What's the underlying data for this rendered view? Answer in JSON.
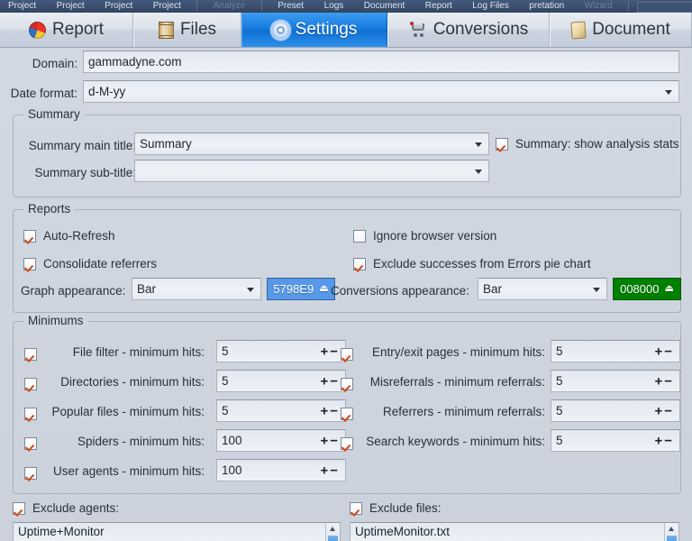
{
  "menu": {
    "items": [
      {
        "label": "Project",
        "faded": false
      },
      {
        "label": "Project",
        "faded": false
      },
      {
        "label": "Project",
        "faded": false
      },
      {
        "label": "Project",
        "faded": false
      },
      {
        "label": "Analyze",
        "faded": true
      },
      {
        "label": "Preset",
        "faded": false
      },
      {
        "label": "Logs",
        "faded": false
      },
      {
        "label": "Document",
        "faded": false
      },
      {
        "label": "Report",
        "faded": false
      },
      {
        "label": "Log Files",
        "faded": false
      },
      {
        "label": "pretation",
        "faded": false
      },
      {
        "label": "Wizard",
        "faded": true
      }
    ]
  },
  "tabs": [
    {
      "label": "Report",
      "icon": "pie-chart-icon",
      "active": false
    },
    {
      "label": "Files",
      "icon": "scroll-icon",
      "active": false
    },
    {
      "label": "Settings",
      "icon": "gear-icon",
      "active": true
    },
    {
      "label": "Conversions",
      "icon": "shopping-cart-icon",
      "active": false
    },
    {
      "label": "Document",
      "icon": "document-icon",
      "active": false
    }
  ],
  "fields": {
    "domain_label": "Domain:",
    "domain_value": "gammadyne.com",
    "date_format_label": "Date format:",
    "date_format_value": "d-M-yy"
  },
  "summary": {
    "title": "Summary",
    "main_title_label": "Summary main title:",
    "main_title_value": "Summary",
    "sub_title_label": "Summary sub-title:",
    "sub_title_value": "",
    "show_stats_label": "Summary: show analysis stats",
    "show_stats_checked": true
  },
  "reports": {
    "title": "Reports",
    "checks": [
      {
        "label": "Auto-Refresh",
        "checked": true
      },
      {
        "label": "Ignore browser version",
        "checked": false
      },
      {
        "label": "Consolidate referrers",
        "checked": true
      },
      {
        "label": "Exclude successes from Errors pie chart",
        "checked": true
      }
    ],
    "graph_appearance_label": "Graph appearance:",
    "graph_appearance_value": "Bar",
    "graph_color_value": "5798E9",
    "graph_color_hex": "#5798E9",
    "conversions_appearance_label": "Conversions appearance:",
    "conversions_appearance_value": "Bar",
    "conversions_color_value": "008000",
    "conversions_color_hex": "#008000"
  },
  "minimums": {
    "title": "Minimums",
    "left": [
      {
        "label": "File filter - minimum hits:",
        "value": "5",
        "checked": true
      },
      {
        "label": "Directories - minimum hits:",
        "value": "5",
        "checked": true
      },
      {
        "label": "Popular files - minimum hits:",
        "value": "5",
        "checked": true
      },
      {
        "label": "Spiders - minimum hits:",
        "value": "100",
        "checked": true
      },
      {
        "label": "User agents - minimum hits:",
        "value": "100",
        "checked": true
      }
    ],
    "right": [
      {
        "label": "Entry/exit pages - minimum hits:",
        "value": "5",
        "checked": true
      },
      {
        "label": "Misreferrals - minimum referrals:",
        "value": "5",
        "checked": true
      },
      {
        "label": "Referrers - minimum referrals:",
        "value": "5",
        "checked": true
      },
      {
        "label": "Search keywords - minimum hits:",
        "value": "5",
        "checked": true
      }
    ],
    "plus": "+",
    "minus": "−"
  },
  "excludes": {
    "agents_label": "Exclude agents:",
    "agents_checked": true,
    "agents_value": "Uptime+Monitor",
    "files_label": "Exclude files:",
    "files_checked": true,
    "files_value": "UptimeMonitor.txt"
  }
}
